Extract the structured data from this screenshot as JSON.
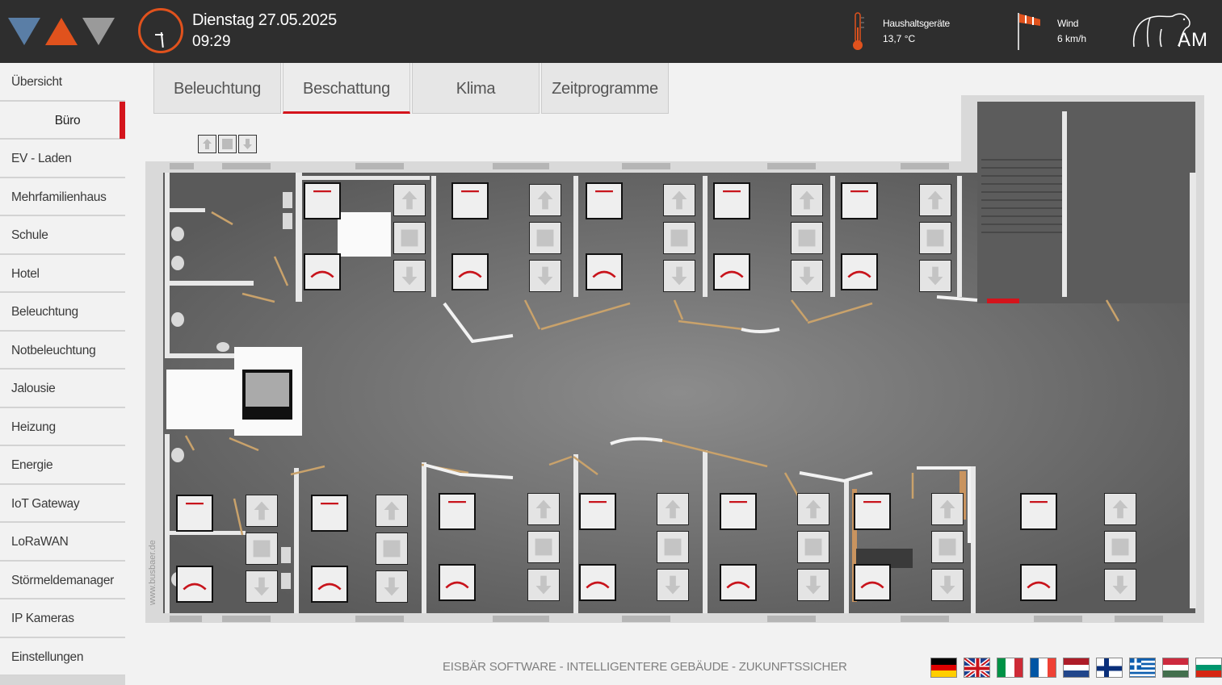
{
  "header": {
    "date": "Dienstag 27.05.2025",
    "time": "09:29",
    "temperature": {
      "label": "Haushaltsgeräte",
      "value": "13,7 °C",
      "icon": "thermometer-icon"
    },
    "wind": {
      "label": "Wind",
      "value": "6 km/h",
      "icon": "windsock-icon"
    },
    "brand_icon": "polar-bear-logo",
    "brand_text": "AM"
  },
  "sidebar": {
    "items": [
      {
        "label": "Übersicht"
      },
      {
        "label": "Büro",
        "active": true
      },
      {
        "label": "EV - Laden"
      },
      {
        "label": "Mehrfamilienhaus"
      },
      {
        "label": "Schule"
      },
      {
        "label": "Hotel"
      },
      {
        "label": "Beleuchtung"
      },
      {
        "label": "Notbeleuchtung"
      },
      {
        "label": "Jalousie"
      },
      {
        "label": "Heizung"
      },
      {
        "label": "Energie"
      },
      {
        "label": "IoT Gateway"
      },
      {
        "label": "LoRaWAN"
      },
      {
        "label": "Störmeldemanager"
      },
      {
        "label": "IP Kameras"
      },
      {
        "label": "Einstellungen"
      }
    ]
  },
  "tabs": [
    {
      "label": "Beleuchtung"
    },
    {
      "label": "Beschattung",
      "active": true
    },
    {
      "label": "Klima"
    },
    {
      "label": "Zeitprogramme"
    }
  ],
  "floorplan": {
    "watermark": "www.busbaer.de",
    "blind_icon_names": [
      "blind-open-icon",
      "blind-closed-icon",
      "arrow-up-icon",
      "stop-icon",
      "arrow-down-icon"
    ]
  },
  "footer": {
    "tagline": "EISBÄR SOFTWARE - INTELLIGENTERE GEBÄUDE - ZUKUNFTSSICHER",
    "languages": [
      "de",
      "en",
      "it",
      "fr",
      "nl",
      "fi",
      "gr",
      "hu",
      "bg"
    ]
  },
  "colors": {
    "accent_orange": "#e0521d",
    "accent_red": "#d4141c",
    "header_bg": "#2e2e2e",
    "logo_blue": "#5a7ea6"
  }
}
